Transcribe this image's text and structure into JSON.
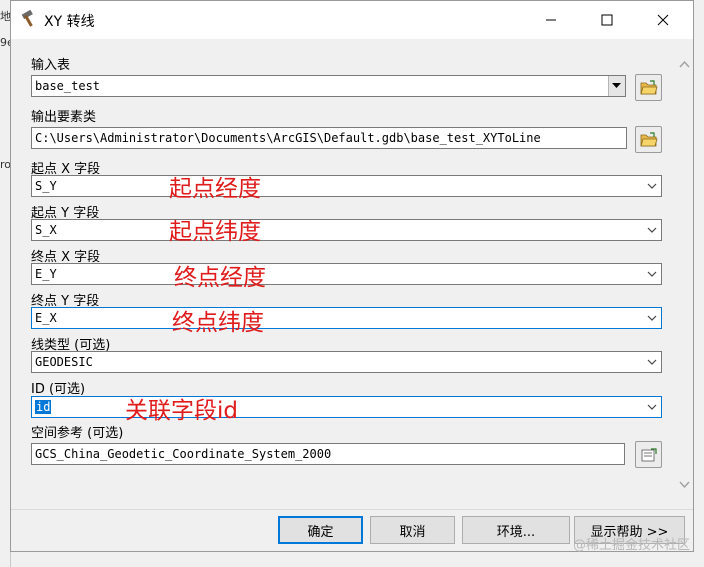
{
  "window": {
    "title": "XY 转线",
    "icon": "hammer-icon",
    "controls": [
      "minimize-icon",
      "maximize-icon",
      "close-icon"
    ]
  },
  "background_fragments": [
    "地",
    "9e",
    "ro"
  ],
  "fields": {
    "input_table": {
      "label": "输入表",
      "value": "base_test"
    },
    "output_features": {
      "label": "输出要素类",
      "value": "C:\\Users\\Administrator\\Documents\\ArcGIS\\Default.gdb\\base_test_XYToLine"
    },
    "start_x": {
      "label": "起点 X 字段",
      "value": "S_Y",
      "annotation": "起点经度"
    },
    "start_y": {
      "label": "起点 Y 字段",
      "value": "S_X",
      "annotation": "起点纬度"
    },
    "end_x": {
      "label": "终点 X 字段",
      "value": "E_Y",
      "annotation": "终点经度"
    },
    "end_y": {
      "label": "终点 Y 字段",
      "value": "E_X",
      "annotation": "终点纬度"
    },
    "line_type": {
      "label": "线类型 (可选)",
      "value": "GEODESIC"
    },
    "id": {
      "label": "ID (可选)",
      "value": "id",
      "annotation": "关联字段id"
    },
    "spatial_reference": {
      "label": "空间参考 (可选)",
      "value": "GCS_China_Geodetic_Coordinate_System_2000"
    }
  },
  "buttons": {
    "ok": "确定",
    "cancel": "取消",
    "environments": "环境...",
    "show_help": "显示帮助 >>"
  },
  "watermark": "@稀土掘金技术社区",
  "colors": {
    "annotation": "#e01b1b",
    "focus": "#0078d7"
  }
}
